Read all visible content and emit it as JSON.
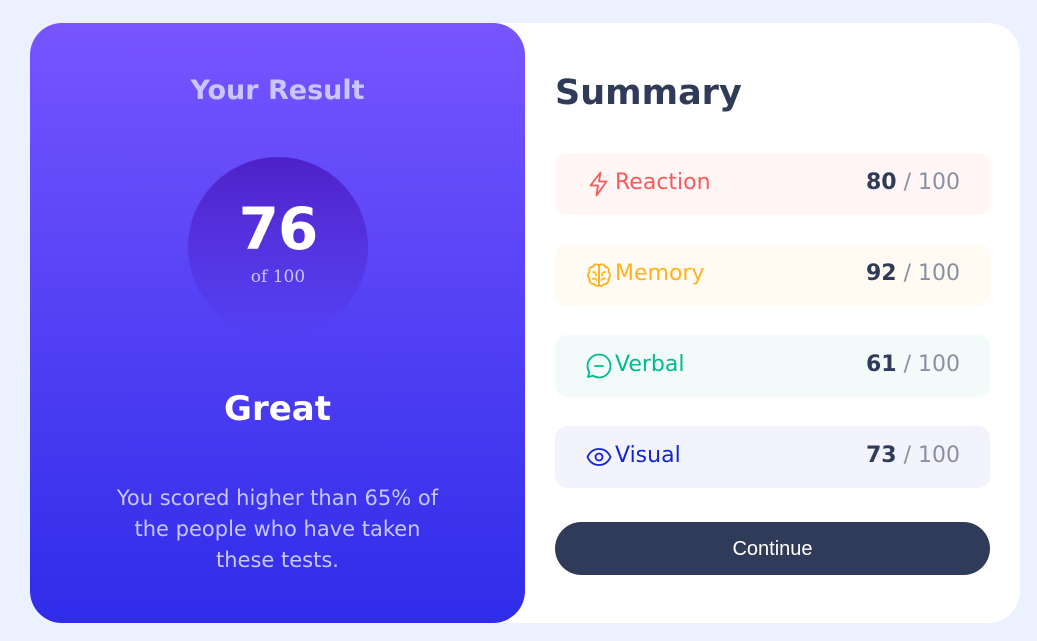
{
  "result": {
    "title": "Your Result",
    "score": "76",
    "of_label": "of 100",
    "rating": "Great",
    "description": "You scored higher than 65% of the people who have taken these tests."
  },
  "summary": {
    "title": "Summary",
    "items": [
      {
        "label": "Reaction",
        "value": "80",
        "max": "/ 100",
        "icon": "lightning-icon",
        "color": "#f55b5b",
        "bg": "#fff6f5"
      },
      {
        "label": "Memory",
        "value": "92",
        "max": "/ 100",
        "icon": "brain-icon",
        "color": "#ffb21e",
        "bg": "#fffbf3"
      },
      {
        "label": "Verbal",
        "value": "61",
        "max": "/ 100",
        "icon": "chat-bubble-icon",
        "color": "#00bb8f",
        "bg": "#f2fbfa"
      },
      {
        "label": "Visual",
        "value": "73",
        "max": "/ 100",
        "icon": "eye-icon",
        "color": "#1125d4",
        "bg": "#f3f3fd"
      }
    ]
  },
  "continue_label": "Continue"
}
